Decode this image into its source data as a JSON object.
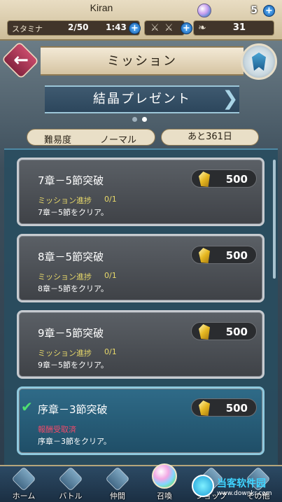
{
  "status": {
    "player_name": "Kiran",
    "orbs": "5",
    "stamina_label": "スタミナ",
    "stamina_value": "2/50",
    "stamina_timer": "1:43",
    "feathers": "31",
    "plus": "+"
  },
  "header": {
    "back_arrow": "←",
    "title": "ミッション"
  },
  "event": {
    "title": "結晶プレゼント",
    "left_arrow": "❮",
    "right_arrow": "❯",
    "page_count": 2,
    "current_page": 2
  },
  "info": {
    "difficulty_label": "難易度",
    "difficulty_value": "ノーマル",
    "remaining": "あと361日"
  },
  "missions": [
    {
      "title": "7章－5節突破",
      "reward": "500",
      "progress_label": "ミッション進捗",
      "progress_value": "0/1",
      "desc": "7章－5節をクリア。",
      "done": false
    },
    {
      "title": "8章－5節突破",
      "reward": "500",
      "progress_label": "ミッション進捗",
      "progress_value": "0/1",
      "desc": "8章－5節をクリア。",
      "done": false
    },
    {
      "title": "9章－5節突破",
      "reward": "500",
      "progress_label": "ミッション進捗",
      "progress_value": "0/1",
      "desc": "9章－5節をクリア。",
      "done": false
    },
    {
      "title": "序章－3節突破",
      "reward": "500",
      "claimed_label": "報酬受取済",
      "desc": "序章－3節をクリア。",
      "done": true,
      "check": "✔"
    }
  ],
  "nav": {
    "home": "ホーム",
    "battle": "バトル",
    "allies": "仲間",
    "summon": "召喚",
    "shop": "ショップ",
    "misc": "その他"
  },
  "watermark": {
    "text": "当客软件园",
    "url": "www.downkr.com"
  },
  "colors": {
    "accent_blue": "#2f6b88",
    "progress_yellow": "#e8d96a",
    "claimed_red": "#f04a6a",
    "check_green": "#4ee070"
  }
}
